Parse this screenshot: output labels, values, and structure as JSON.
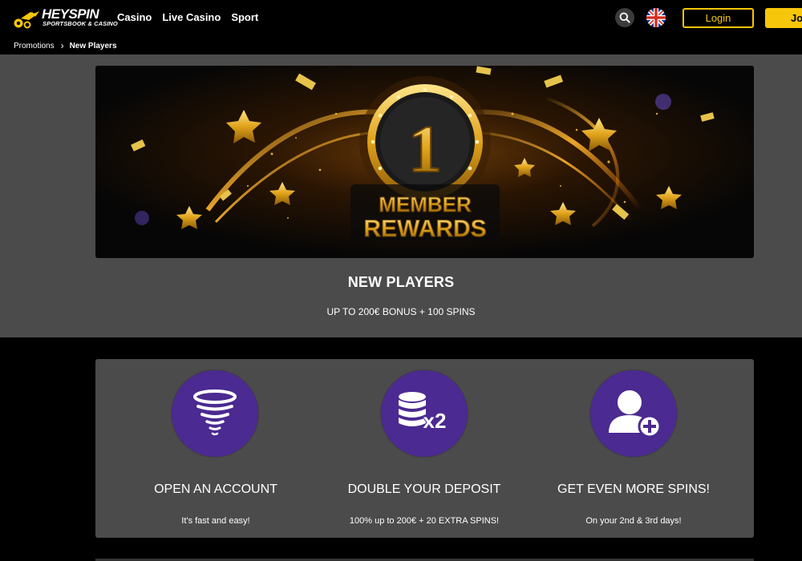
{
  "header": {
    "logo_text": "HEYSPIN",
    "logo_sub": "SPORTSBOOK & CASINO",
    "nav": [
      "Casino",
      "Live Casino",
      "Sport"
    ],
    "search_icon": "search-icon",
    "flag_icon": "uk-flag-icon",
    "login_label": "Login",
    "join_label": "Join"
  },
  "breadcrumb": {
    "items": [
      "Promotions",
      "New Players"
    ],
    "separator_icon": "chevron-right-icon"
  },
  "hero": {
    "banner_number": "1",
    "banner_line1": "MEMBER",
    "banner_line2": "REWARDS",
    "title": "NEW PLAYERS",
    "subtitle": "UP TO 200€ BONUS + 100 SPINS"
  },
  "steps": [
    {
      "icon": "tornado-icon",
      "title": "OPEN AN ACCOUNT",
      "desc": "It's fast and easy!"
    },
    {
      "icon": "coins-x2-icon",
      "title": "DOUBLE YOUR DEPOSIT",
      "desc": "100% up to 200€ + 20 EXTRA SPINS!"
    },
    {
      "icon": "add-user-icon",
      "title": "GET EVEN MORE SPINS!",
      "desc": "On your 2nd & 3rd days!"
    }
  ],
  "colors": {
    "brand_yellow": "#f6c60a",
    "panel_grey": "#4b4b4b",
    "icon_purple": "#4b2a91",
    "background": "#000000"
  }
}
